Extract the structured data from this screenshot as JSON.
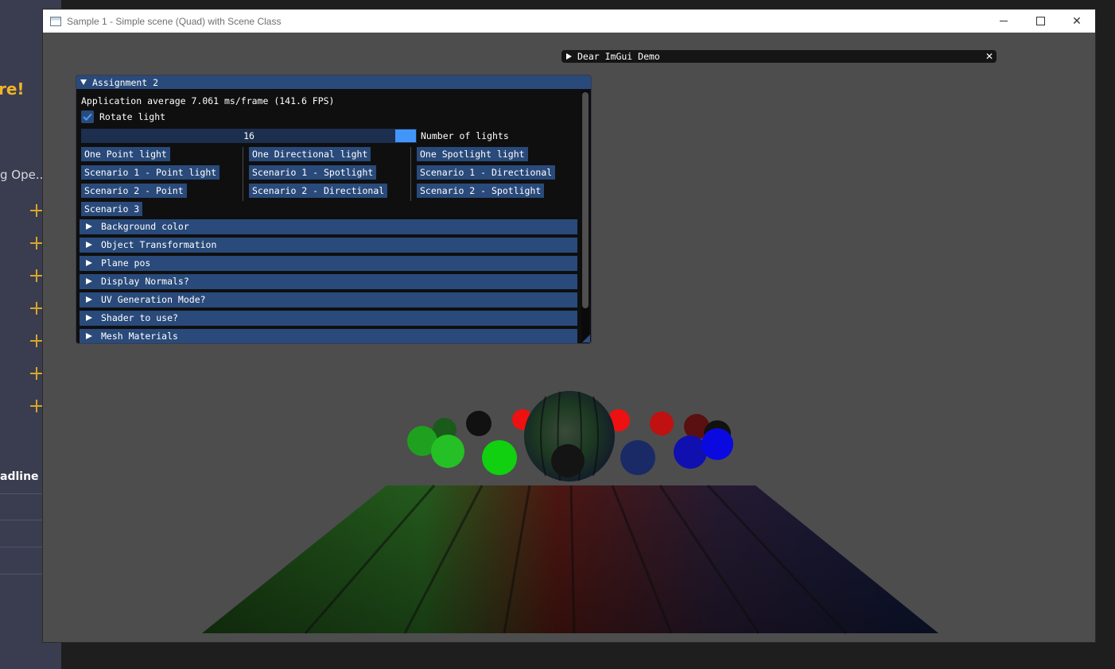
{
  "background_app": {
    "headline_fragment": "re!",
    "item_fragment": "g Ope...",
    "deadline_fragment": "adline",
    "accent_color": "#f0b429"
  },
  "window": {
    "title": "Sample 1 - Simple scene (Quad) with Scene Class",
    "close_glyph": "✕"
  },
  "demo_window": {
    "title": "Dear ImGui Demo",
    "close_glyph": "✕"
  },
  "panel": {
    "title": "Assignment 2",
    "fps_text": "Application average 7.061 ms/frame (141.6 FPS)",
    "rotate_light": {
      "label": "Rotate light",
      "checked": true
    },
    "lights_slider": {
      "value": "16",
      "label": "Number of lights"
    },
    "columns": [
      [
        "One Point light",
        "Scenario 1 - Point light",
        "Scenario 2 - Point",
        "Scenario 3"
      ],
      [
        "One Directional light",
        "Scenario 1 - Spotlight",
        "Scenario 2 - Directional"
      ],
      [
        "One Spotlight light",
        "Scenario 1 - Directional",
        "Scenario 2 - Spotlight"
      ]
    ],
    "headers": [
      "Background color",
      "Object Transformation",
      "Plane pos",
      "Display Normals?",
      "UV Generation Mode?",
      "Shader to use?",
      "Mesh Materials"
    ],
    "accent_color": "#294a7a",
    "slider_grab_color": "#4296fa"
  }
}
